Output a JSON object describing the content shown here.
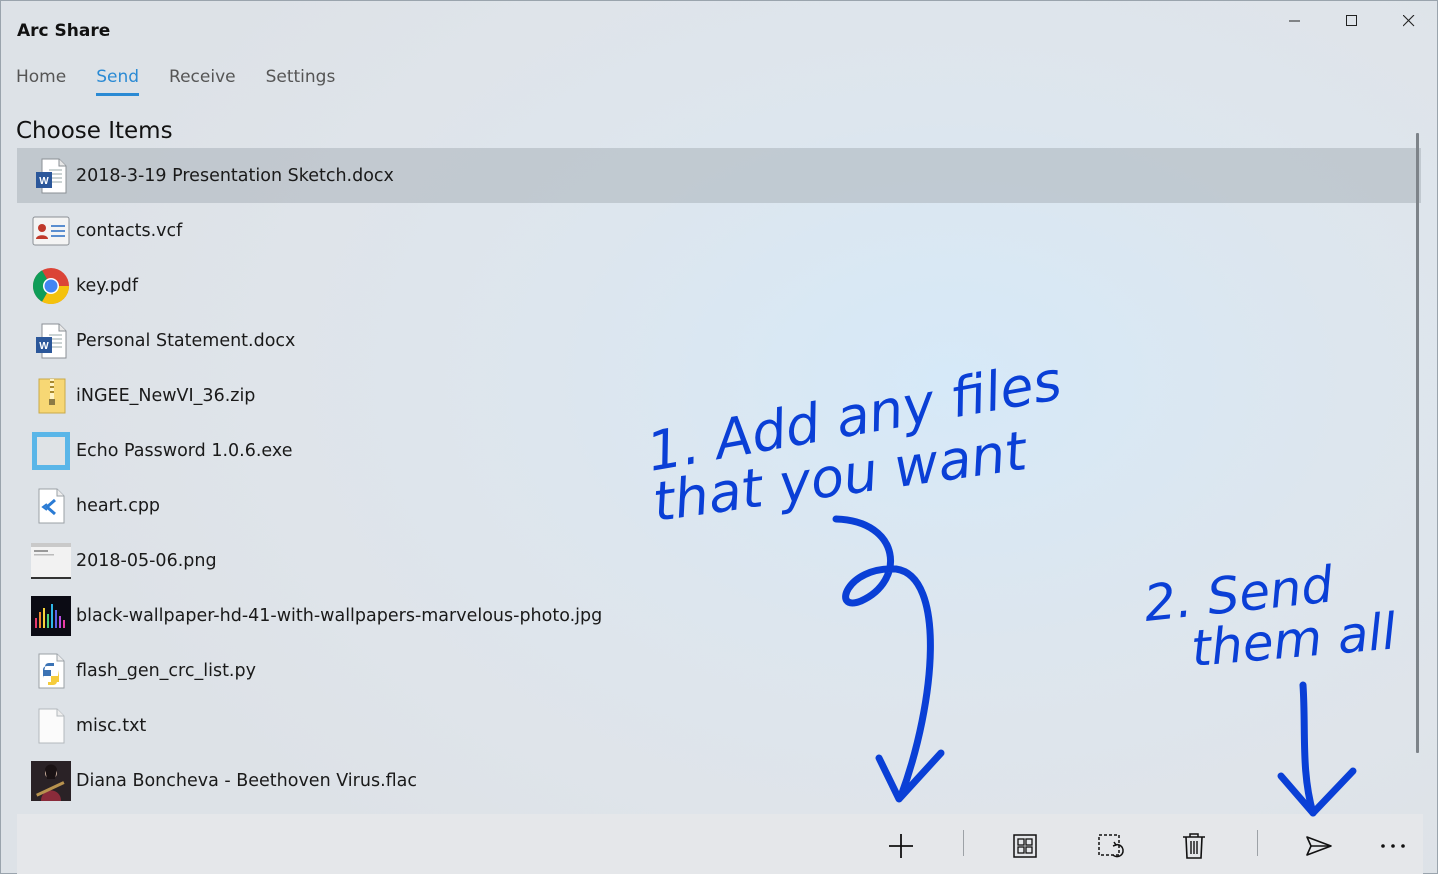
{
  "app": {
    "title": "Arc Share"
  },
  "window_controls": {
    "minimize_icon": "minimize-icon",
    "maximize_icon": "maximize-icon",
    "close_icon": "close-icon"
  },
  "nav": {
    "tabs": [
      {
        "label": "Home",
        "active": false
      },
      {
        "label": "Send",
        "active": true
      },
      {
        "label": "Receive",
        "active": false
      },
      {
        "label": "Settings",
        "active": false
      }
    ],
    "accent_color": "#2a8ad4"
  },
  "main": {
    "section_title": "Choose Items",
    "files": [
      {
        "name": "2018-3-19 Presentation Sketch.docx",
        "icon": "word-document-icon",
        "selected": true
      },
      {
        "name": "contacts.vcf",
        "icon": "contact-card-icon",
        "selected": false
      },
      {
        "name": "key.pdf",
        "icon": "chrome-icon",
        "selected": false
      },
      {
        "name": "Personal Statement.docx",
        "icon": "word-document-icon",
        "selected": false
      },
      {
        "name": "iNGEE_NewVI_36.zip",
        "icon": "zip-folder-icon",
        "selected": false
      },
      {
        "name": "Echo Password 1.0.6.exe",
        "icon": "app-exe-icon",
        "selected": false
      },
      {
        "name": "heart.cpp",
        "icon": "vscode-file-icon",
        "selected": false
      },
      {
        "name": "2018-05-06.png",
        "icon": "image-thumbnail-icon",
        "selected": false
      },
      {
        "name": "black-wallpaper-hd-41-with-wallpapers-marvelous-photo.jpg",
        "icon": "wallpaper-thumbnail-icon",
        "selected": false
      },
      {
        "name": "flash_gen_crc_list.py",
        "icon": "python-file-icon",
        "selected": false
      },
      {
        "name": "misc.txt",
        "icon": "text-file-icon",
        "selected": false
      },
      {
        "name": "Diana Boncheva - Beethoven Virus.flac",
        "icon": "album-art-icon",
        "selected": false
      }
    ]
  },
  "command_bar": {
    "buttons": [
      {
        "name": "add-button",
        "icon": "plus-icon"
      },
      {
        "name": "select-all-button",
        "icon": "select-all-icon"
      },
      {
        "name": "clear-selection-button",
        "icon": "clear-selection-icon"
      },
      {
        "name": "delete-button",
        "icon": "trash-icon"
      },
      {
        "name": "send-button",
        "icon": "send-icon"
      },
      {
        "name": "more-button",
        "icon": "more-icon"
      }
    ]
  },
  "annotations": {
    "note_1_line_1": "1. Add any files",
    "note_1_line_2": "that you want",
    "note_2_line_1": "2. Send",
    "note_2_line_2": "them all",
    "ink_color": "#0a3fd6"
  }
}
